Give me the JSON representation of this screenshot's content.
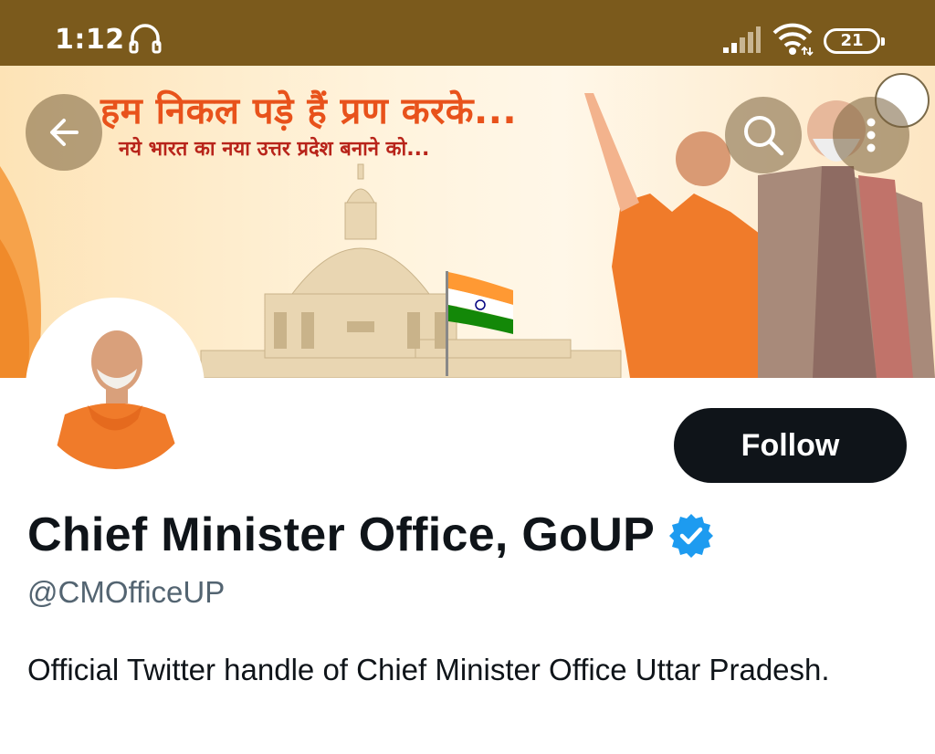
{
  "status_bar": {
    "time": "1:12",
    "battery": "21",
    "icons": [
      "headphone-icon",
      "signal-icon",
      "wifi-icon",
      "battery-icon"
    ]
  },
  "banner": {
    "headline": "हम निकल पड़े हैं प्रण करके...",
    "subline": "नये भारत का नया उत्तर प्रदेश बनाने को..."
  },
  "header_actions": {
    "back_icon": "arrow-left-icon",
    "search_icon": "search-icon",
    "more_icon": "more-vertical-icon"
  },
  "profile": {
    "display_name": "Chief Minister Office, GoUP",
    "verified": true,
    "handle": "@CMOfficeUP",
    "bio": "Official Twitter handle of Chief Minister Office Uttar Pradesh.",
    "follow_label": "Follow"
  },
  "colors": {
    "status_bar": "#7b5a1c",
    "follow_button": "#0f1419",
    "verified_badge": "#1d9bf0",
    "handle_text": "#536471",
    "headline": "#e8521b",
    "subline": "#b8241a"
  }
}
